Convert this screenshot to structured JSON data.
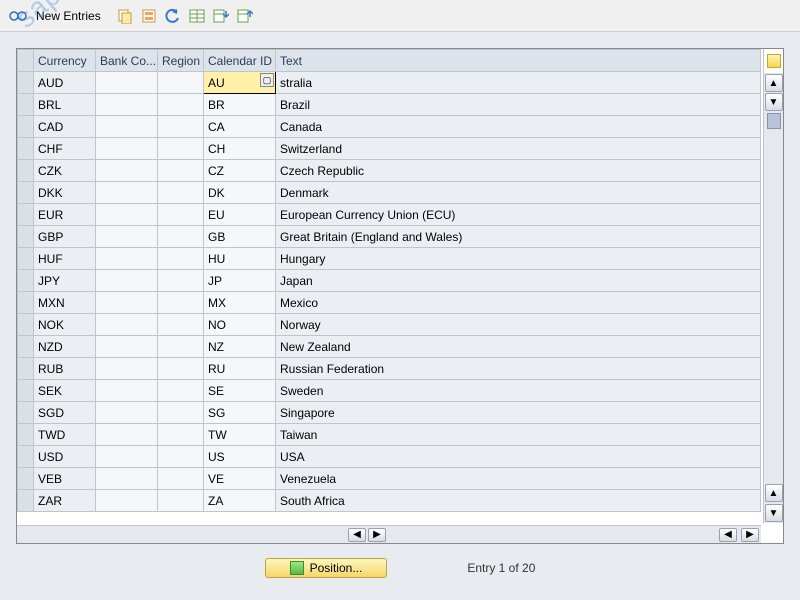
{
  "toolbar": {
    "new_entries_label": "New Entries"
  },
  "columns": {
    "currency": "Currency",
    "bank": "Bank Co...",
    "region": "Region",
    "calendar": "Calendar ID",
    "text": "Text"
  },
  "rows": [
    {
      "currency": "AUD",
      "bank": "",
      "region": "",
      "cal": "AU",
      "text": "stralia",
      "active": true
    },
    {
      "currency": "BRL",
      "bank": "",
      "region": "",
      "cal": "BR",
      "text": "Brazil"
    },
    {
      "currency": "CAD",
      "bank": "",
      "region": "",
      "cal": "CA",
      "text": "Canada"
    },
    {
      "currency": "CHF",
      "bank": "",
      "region": "",
      "cal": "CH",
      "text": "Switzerland"
    },
    {
      "currency": "CZK",
      "bank": "",
      "region": "",
      "cal": "CZ",
      "text": "Czech Republic"
    },
    {
      "currency": "DKK",
      "bank": "",
      "region": "",
      "cal": "DK",
      "text": "Denmark"
    },
    {
      "currency": "EUR",
      "bank": "",
      "region": "",
      "cal": "EU",
      "text": "European Currency Union (ECU)"
    },
    {
      "currency": "GBP",
      "bank": "",
      "region": "",
      "cal": "GB",
      "text": "Great Britain (England and Wales)"
    },
    {
      "currency": "HUF",
      "bank": "",
      "region": "",
      "cal": "HU",
      "text": "Hungary"
    },
    {
      "currency": "JPY",
      "bank": "",
      "region": "",
      "cal": "JP",
      "text": "Japan"
    },
    {
      "currency": "MXN",
      "bank": "",
      "region": "",
      "cal": "MX",
      "text": "Mexico"
    },
    {
      "currency": "NOK",
      "bank": "",
      "region": "",
      "cal": "NO",
      "text": "Norway"
    },
    {
      "currency": "NZD",
      "bank": "",
      "region": "",
      "cal": "NZ",
      "text": "New Zealand"
    },
    {
      "currency": "RUB",
      "bank": "",
      "region": "",
      "cal": "RU",
      "text": "Russian Federation"
    },
    {
      "currency": "SEK",
      "bank": "",
      "region": "",
      "cal": "SE",
      "text": "Sweden"
    },
    {
      "currency": "SGD",
      "bank": "",
      "region": "",
      "cal": "SG",
      "text": "Singapore"
    },
    {
      "currency": "TWD",
      "bank": "",
      "region": "",
      "cal": "TW",
      "text": "Taiwan"
    },
    {
      "currency": "USD",
      "bank": "",
      "region": "",
      "cal": "US",
      "text": "USA"
    },
    {
      "currency": "VEB",
      "bank": "",
      "region": "",
      "cal": "VE",
      "text": "Venezuela"
    },
    {
      "currency": "ZAR",
      "bank": "",
      "region": "",
      "cal": "ZA",
      "text": "South Africa"
    }
  ],
  "footer": {
    "position_label": "Position...",
    "entry_info": "Entry 1 of 20"
  },
  "watermark": "sapbrainsonline.com"
}
